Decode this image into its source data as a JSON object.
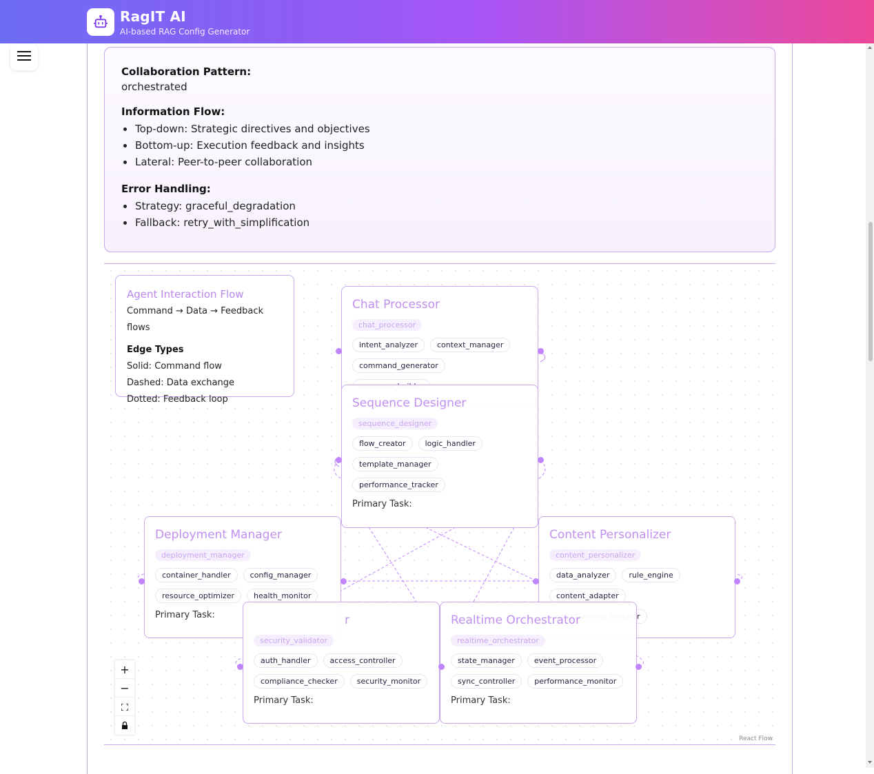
{
  "app": {
    "title": "RagIT AI",
    "subtitle": "AI-based RAG Config Generator",
    "logo_icon": "robot-icon"
  },
  "menu": {
    "icon": "hamburger-icon"
  },
  "info": {
    "collab_label": "Collaboration Pattern:",
    "collab_value": "orchestrated",
    "flow_label": "Information Flow:",
    "flow_items": [
      "Top-down: Strategic directives and objectives",
      "Bottom-up: Execution feedback and insights",
      "Lateral: Peer-to-peer collaboration"
    ],
    "error_label": "Error Handling:",
    "error_items": [
      "Strategy: graceful_degradation",
      "Fallback: retry_with_simplification"
    ]
  },
  "legend": {
    "title": "Agent Interaction Flow",
    "subtitle": "Command → Data → Feedback flows",
    "edge_types_label": "Edge Types",
    "solid": "Solid: Command flow",
    "dashed": "Dashed: Data exchange",
    "dotted": "Dotted: Feedback loop"
  },
  "nodes": {
    "chat": {
      "title": "Chat Processor",
      "id": "chat_processor",
      "caps": [
        "intent_analyzer",
        "context_manager",
        "command_generator",
        "response_builder"
      ]
    },
    "sequence": {
      "title": "Sequence Designer",
      "id": "sequence_designer",
      "caps": [
        "flow_creator",
        "logic_handler",
        "template_manager",
        "performance_tracker"
      ],
      "primary_task": "Primary Task:"
    },
    "deploy": {
      "title": "Deployment Manager",
      "id": "deployment_manager",
      "caps": [
        "container_handler",
        "config_manager",
        "resource_optimizer",
        "health_monitor"
      ],
      "primary_task": "Primary Task:"
    },
    "content": {
      "title": "Content Personalizer",
      "id": "content_personalizer",
      "caps": [
        "data_analyzer",
        "rule_engine",
        "content_adapter",
        "effectiveness_monitor"
      ]
    },
    "security": {
      "title_tail": "r",
      "id": "security_validator",
      "caps": [
        "auth_handler",
        "access_controller",
        "compliance_checker",
        "security_monitor"
      ],
      "primary_task": "Primary Task:"
    },
    "realtime": {
      "title": "Realtime Orchestrator",
      "id": "realtime_orchestrator",
      "caps": [
        "state_manager",
        "event_processor",
        "sync_controller",
        "performance_monitor"
      ],
      "primary_task": "Primary Task:"
    }
  },
  "controls": {
    "zoom_in": "+",
    "zoom_out": "−",
    "fit": "fit-view-icon",
    "lock": "lock-icon"
  },
  "attribution": "React Flow"
}
